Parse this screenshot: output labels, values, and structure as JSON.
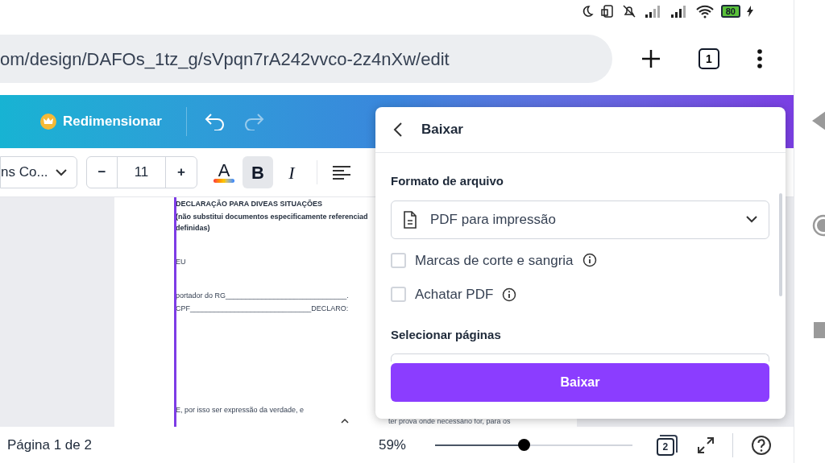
{
  "status_bar": {
    "battery": "80"
  },
  "browser": {
    "url": "om/design/DAFOs_1tz_g/sVpqn7rA242vvco-2z4nXw/edit",
    "tab_count": "1"
  },
  "toolbar": {
    "resize_label": "Redimensionar"
  },
  "format_bar": {
    "font": "ns Co...",
    "minus": "−",
    "size": "11",
    "plus": "+",
    "styles": [
      {
        "kind": "color",
        "label": "A",
        "selected": false
      },
      {
        "kind": "bold",
        "label": "B",
        "selected": true
      },
      {
        "kind": "italic",
        "label": "I",
        "selected": false
      }
    ]
  },
  "document": {
    "lines": [
      {
        "text": "DECLARAÇÃO PARA DIVEAS SITUAÇÕES",
        "bold": true
      },
      {
        "text": "(não substitui documentos especificamente referenciad",
        "bold": true
      },
      {
        "text": "definidas)",
        "bold": true
      },
      {
        "text": "EU",
        "bold": false
      },
      {
        "text": "portador do RG______________________________.",
        "bold": false
      },
      {
        "text": "CPF______________________________DECLARO:",
        "bold": false
      },
      {
        "text": "E, por isso ser expressão da verdade, e",
        "bold": false
      }
    ],
    "hidden_tail": "ter prova onde necessário for, para os"
  },
  "download_panel": {
    "title": "Baixar",
    "format_label": "Formato de arquivo",
    "format_value": "PDF para impressão",
    "options": [
      {
        "label": "Marcas de corte e sangria",
        "checked": false
      },
      {
        "label": "Achatar PDF",
        "checked": false
      }
    ],
    "pages_label": "Selecionar páginas",
    "button": "Baixar"
  },
  "footer": {
    "page": "Página 1 de 2",
    "zoom": "59%",
    "zoom_slider": {
      "level": 0.45
    },
    "page_count": "2"
  }
}
